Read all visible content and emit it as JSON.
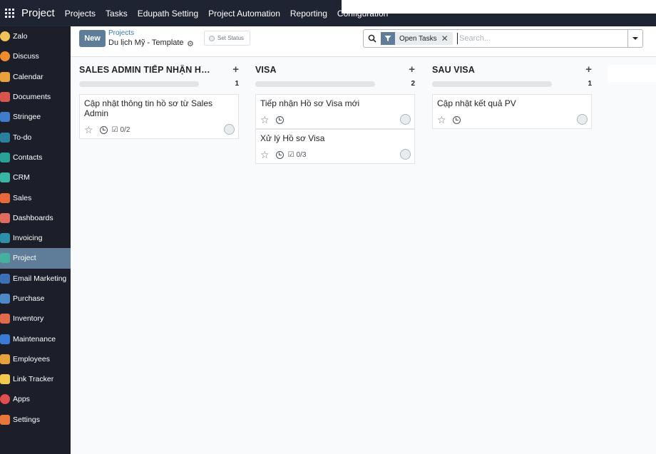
{
  "navbar": {
    "brand": "Project",
    "menu": [
      "Projects",
      "Tasks",
      "Edupath Setting",
      "Project Automation",
      "Reporting",
      "Configuration"
    ]
  },
  "sidebar": {
    "items": [
      {
        "label": "Zalo",
        "icon": "zalo-icon",
        "color": "#f0c35a"
      },
      {
        "label": "Discuss",
        "icon": "discuss-icon",
        "color": "#f08a2e"
      },
      {
        "label": "Calendar",
        "icon": "calendar-icon",
        "color": "#e9a23b"
      },
      {
        "label": "Documents",
        "icon": "documents-icon",
        "color": "#d9534f"
      },
      {
        "label": "Stringee",
        "icon": "stringee-icon",
        "color": "#3f7cc9"
      },
      {
        "label": "To-do",
        "icon": "todo-icon",
        "color": "#2a7f9e"
      },
      {
        "label": "Contacts",
        "icon": "contacts-icon",
        "color": "#2aa198"
      },
      {
        "label": "CRM",
        "icon": "crm-icon",
        "color": "#39b7a2"
      },
      {
        "label": "Sales",
        "icon": "sales-icon",
        "color": "#e8683a"
      },
      {
        "label": "Dashboards",
        "icon": "dashboards-icon",
        "color": "#e36b5d"
      },
      {
        "label": "Invoicing",
        "icon": "invoicing-icon",
        "color": "#2d8fa8"
      },
      {
        "label": "Project",
        "icon": "project-icon",
        "color": "#45b0a0"
      },
      {
        "label": "Email Marketing",
        "icon": "email-marketing-icon",
        "color": "#3d6fb6"
      },
      {
        "label": "Purchase",
        "icon": "purchase-icon",
        "color": "#4e88c7"
      },
      {
        "label": "Inventory",
        "icon": "inventory-icon",
        "color": "#e06a4a"
      },
      {
        "label": "Maintenance",
        "icon": "maintenance-icon",
        "color": "#3a7bd5"
      },
      {
        "label": "Employees",
        "icon": "employees-icon",
        "color": "#e9a23b"
      },
      {
        "label": "Link Tracker",
        "icon": "link-tracker-icon",
        "color": "#f2c94c"
      },
      {
        "label": "Apps",
        "icon": "apps-icon",
        "color": "#e24d4d"
      },
      {
        "label": "Settings",
        "icon": "settings-icon",
        "color": "#e8783a"
      }
    ],
    "active": "Project",
    "active_color": "#5f7d98"
  },
  "control": {
    "new_label": "New",
    "breadcrumb_parent": "Projects",
    "breadcrumb_current": "Du lịch Mỹ - Template",
    "set_status": "Set Status",
    "facet_label": "Open Tasks",
    "search_placeholder": "Search..."
  },
  "columns": [
    {
      "title": "SALES ADMIN TIẾP NHẬN HỒ ...",
      "count": "1",
      "cards": [
        {
          "title": "Cập nhật thông tin hồ sơ từ Sales Admin",
          "checklist": "0/2"
        }
      ]
    },
    {
      "title": "VISA",
      "count": "2",
      "cards": [
        {
          "title": "Tiếp nhận Hồ sơ Visa mới",
          "checklist": ""
        },
        {
          "title": "Xử lý Hồ sơ Visa",
          "checklist": "0/3"
        }
      ]
    },
    {
      "title": "SAU VISA",
      "count": "1",
      "cards": [
        {
          "title": "Cập nhật kết quả PV",
          "checklist": ""
        }
      ]
    }
  ],
  "colors": {
    "navbar": "#1f2433",
    "sidebar": "#1c1f2a",
    "accent": "#5f7d98"
  }
}
